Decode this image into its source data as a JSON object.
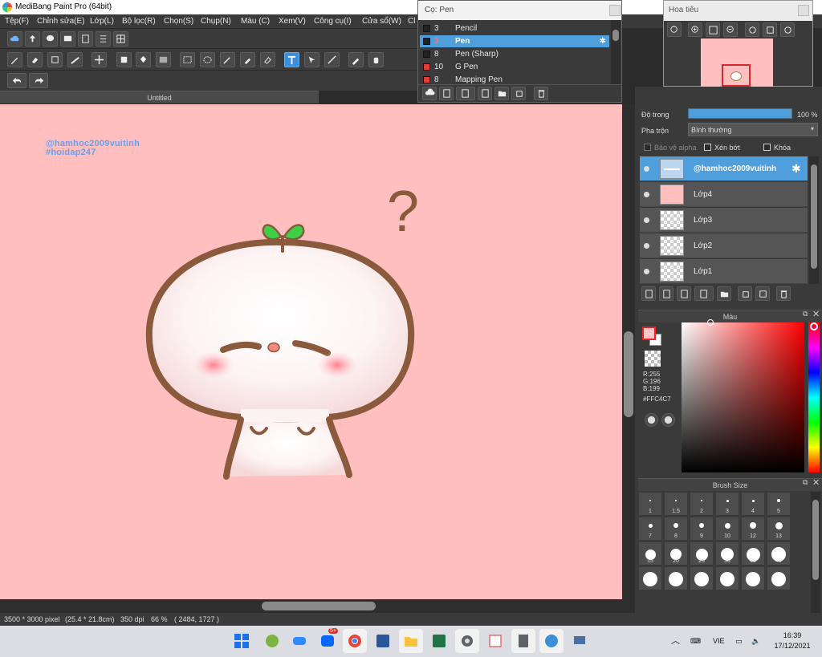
{
  "window": {
    "title": "MediBang Paint Pro (64bit)"
  },
  "menu": [
    "Tệp(F)",
    "Chỉnh sửa(E)",
    "Lớp(L)",
    "Bộ lọc(R)",
    "Chọn(S)",
    "Chụp(N)",
    "Màu (C)",
    "Xem(V)",
    "Công cụ(I)",
    "Cửa sổ(W)",
    "Cl"
  ],
  "document": {
    "tab": "Untitled"
  },
  "canvas": {
    "watermark_line1": "@hamhoc2009vuitinh",
    "watermark_line2": "#hoidap247",
    "background_color": "#ffbfbf",
    "question_mark": "?"
  },
  "status": {
    "size": "3500 * 3000 pixel",
    "cm": "(25.4 * 21.8cm)",
    "dpi": "350 dpi",
    "zoom": "66 %",
    "coords": "( 2484, 1727 )"
  },
  "brush_window": {
    "title": "Cọ: Pen",
    "items": [
      {
        "size": "3",
        "name": "Pencil",
        "color": "#222222"
      },
      {
        "size": "3",
        "name": "Pen",
        "color": "#222222"
      },
      {
        "size": "8",
        "name": "Pen (Sharp)",
        "color": "#222222"
      },
      {
        "size": "10",
        "name": "G Pen",
        "color": "#e53b3b"
      },
      {
        "size": "8",
        "name": "Mapping Pen",
        "color": "#e53b3b"
      }
    ]
  },
  "navigator": {
    "title": "Hoa tiêu"
  },
  "layers_panel": {
    "opacity_label": "Độ trong",
    "opacity_value": "100 %",
    "opacity_fraction": 1.0,
    "blend_label": "Pha trộn",
    "blend_value": "Bình thường",
    "protect_alpha": "Bảo vệ alpha",
    "clipping": "Xén bớt",
    "lock": "Khóa",
    "layers": [
      {
        "name": "@hamhoc2009vuitinh",
        "selected": true
      },
      {
        "name": "Lớp4",
        "selected": false
      },
      {
        "name": "Lớp3",
        "selected": false
      },
      {
        "name": "Lớp2",
        "selected": false
      },
      {
        "name": "Lớp1",
        "selected": false
      }
    ]
  },
  "color_panel": {
    "title": "Màu",
    "r": "R:255",
    "g": "G:196",
    "b": "B:199",
    "hex": "#FFC4C7",
    "primary": "#ffc4c7"
  },
  "brush_size_panel": {
    "title": "Brush Size",
    "sizes": [
      "1",
      "1.5",
      "2",
      "3",
      "4",
      "5",
      "7",
      "8",
      "9",
      "10",
      "12",
      "13",
      "15",
      "20",
      "25",
      "30",
      "35",
      "40",
      "",
      "",
      "",
      "",
      "",
      ""
    ]
  },
  "taskbar": {
    "time": "16:39",
    "date": "17/12/2021",
    "lang": "VIE",
    "badge": "5+"
  }
}
